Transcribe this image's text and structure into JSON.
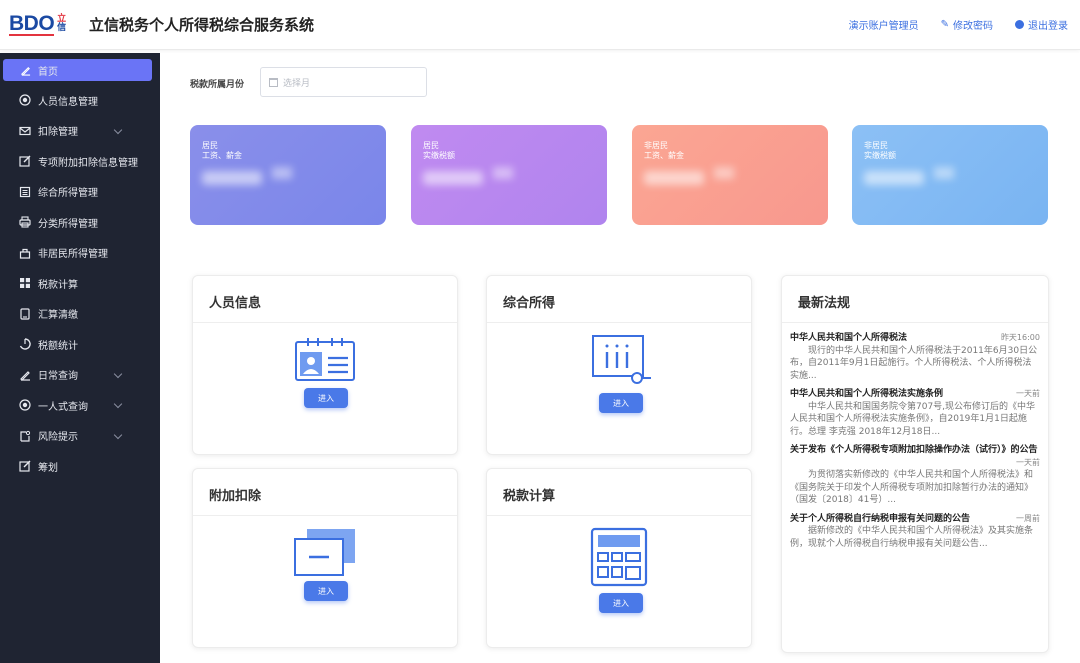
{
  "header": {
    "logo_text": "BDO",
    "logo_cn_1": "立",
    "logo_cn_2": "信",
    "title": "立信税务个人所得税综合服务系统",
    "user": "演示账户管理员",
    "change_password": "修改密码",
    "logout": "退出登录",
    "accent_color": "#3b6fe0"
  },
  "sidebar": {
    "items": [
      {
        "label": "首页",
        "icon": "home-icon"
      },
      {
        "label": "人员信息管理",
        "icon": "person-icon"
      },
      {
        "label": "扣除管理",
        "icon": "mail-icon"
      },
      {
        "label": "专项附加扣除信息管理",
        "icon": "edit-icon"
      },
      {
        "label": "综合所得管理",
        "icon": "calendar-icon"
      },
      {
        "label": "分类所得管理",
        "icon": "printer-icon"
      },
      {
        "label": "非居民所得管理",
        "icon": "bag-icon"
      },
      {
        "label": "税款计算",
        "icon": "grid-icon"
      },
      {
        "label": "汇算清缴",
        "icon": "tablet-icon"
      },
      {
        "label": "税额统计",
        "icon": "stats-icon"
      },
      {
        "label": "日常查询",
        "icon": "pen-icon"
      },
      {
        "label": "一人式查询",
        "icon": "target-icon"
      },
      {
        "label": "风险提示",
        "icon": "alert-icon"
      },
      {
        "label": "筹划",
        "icon": "plan-icon"
      }
    ]
  },
  "filter": {
    "label": "税款所属月份",
    "placeholder": "选择月"
  },
  "stats": [
    {
      "line1": "居民",
      "line2": "工资、薪金",
      "color": "#7f8ae9"
    },
    {
      "line1": "居民",
      "line2": "实缴税额",
      "color": "#b889ef"
    },
    {
      "line1": "非居民",
      "line2": "工资、薪金",
      "color": "#f99e8f"
    },
    {
      "line1": "非居民",
      "line2": "实缴税额",
      "color": "#82b9f3"
    }
  ],
  "modules": {
    "enter_label": "进入",
    "personnel": "人员信息",
    "comprehensive": "综合所得",
    "deduction": "附加扣除",
    "tax_calc": "税款计算"
  },
  "laws": {
    "title": "最新法规",
    "items": [
      {
        "title": "中华人民共和国个人所得税法",
        "time": "昨天16:00",
        "desc": "现行的中华人民共和国个人所得税法于2011年6月30日公布，自2011年9月1日起施行。个人所得税法、个人所得税法实施..."
      },
      {
        "title": "中华人民共和国个人所得税法实施条例",
        "time": "一天前",
        "desc": "中华人民共和国国务院令第707号,现公布修订后的《中华人民共和国个人所得税法实施条例》，自2019年1月1日起施行。总理 李克强 2018年12月18日..."
      },
      {
        "title": "关于发布《个人所得税专项附加扣除操作办法（试行）》的公告",
        "time": "一天前",
        "desc": "为贯彻落实新修改的《中华人民共和国个人所得税法》和《国务院关于印发个人所得税专项附加扣除暂行办法的通知》（国发〔2018〕41号）..."
      },
      {
        "title": "关于个人所得税自行纳税申报有关问题的公告",
        "time": "一周前",
        "desc": "据新修改的《中华人民共和国个人所得税法》及其实施条例，现就个人所得税自行纳税申报有关问题公告..."
      }
    ]
  }
}
